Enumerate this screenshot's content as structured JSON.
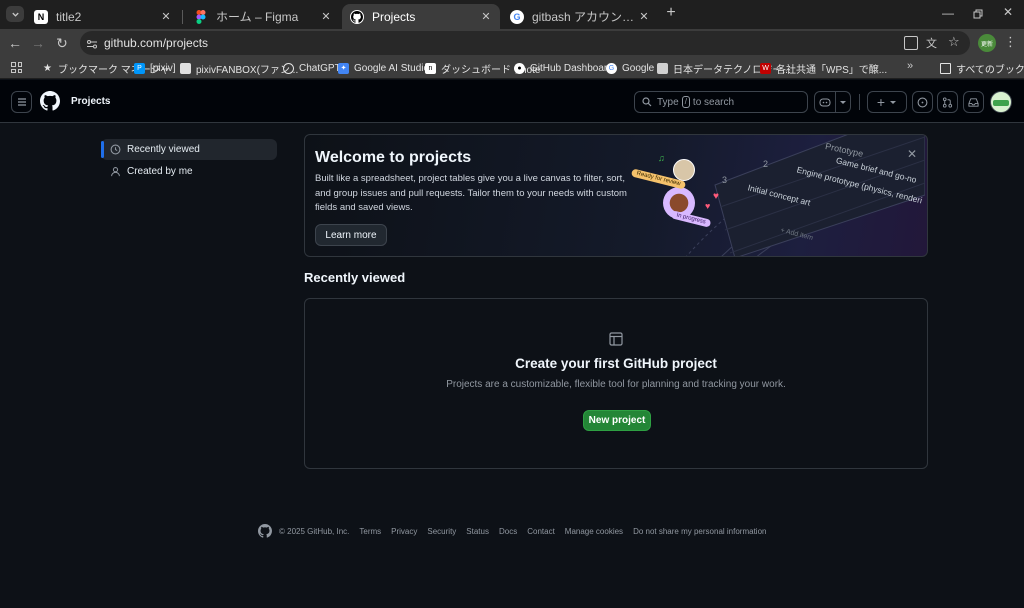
{
  "browser": {
    "tabs": [
      {
        "label": "title2",
        "icon": "notion-icon",
        "active": false
      },
      {
        "label": "ホーム – Figma",
        "icon": "figma-icon",
        "active": false
      },
      {
        "label": "Projects",
        "icon": "github-icon",
        "active": true
      },
      {
        "label": "gitbash アカウント 確認 - Google",
        "icon": "google-icon",
        "active": false
      }
    ],
    "url": "github.com/projects",
    "profile_label": "更新",
    "bookmarks": [
      {
        "label": "ブックマーク マネージャ"
      },
      {
        "label": "[pixiv]"
      },
      {
        "label": "pixivFANBOX(ファン..."
      },
      {
        "label": "ChatGPT"
      },
      {
        "label": "Google AI Studio"
      },
      {
        "label": "ダッシュボード｜note"
      },
      {
        "label": "GitHub Dashboard"
      },
      {
        "label": "Google"
      },
      {
        "label": "日本データテクノロジー..."
      },
      {
        "label": "各社共通「WPS」で醸..."
      }
    ],
    "all_bookmarks_label": "すべてのブックマーク"
  },
  "header": {
    "title": "Projects",
    "search_prefix": "Type",
    "search_key": "/",
    "search_suffix": "to search"
  },
  "sidebar": {
    "items": [
      {
        "label": "Recently viewed",
        "icon": "clock-icon",
        "selected": true
      },
      {
        "label": "Created by me",
        "icon": "person-icon",
        "selected": false
      }
    ]
  },
  "welcome": {
    "title": "Welcome to projects",
    "description": "Built like a spreadsheet, project tables give you a live canvas to filter, sort, and group issues and pull requests. Tailor them to your needs with custom fields and saved views.",
    "learn_more_label": "Learn more",
    "illustration": {
      "col1": "Prototype",
      "item1": "Game brief and go-no",
      "item2": "Engine prototype (physics, renderi",
      "item3": "Initial concept art",
      "add_item": "+ Add item",
      "badge_ready": "Ready for review",
      "badge_progress": "In progress",
      "num2": "2",
      "num3": "3"
    }
  },
  "recent": {
    "heading": "Recently viewed",
    "empty_title": "Create your first GitHub project",
    "empty_desc": "Projects are a customizable, flexible tool for planning and tracking your work.",
    "new_project_label": "New project"
  },
  "footer": {
    "copyright": "© 2025 GitHub, Inc.",
    "links": [
      "Terms",
      "Privacy",
      "Security",
      "Status",
      "Docs",
      "Contact",
      "Manage cookies",
      "Do not share my personal information"
    ]
  },
  "colors": {
    "accent_blue": "#1f6feb",
    "primary_green": "#238636",
    "page_bg": "#0d1117"
  }
}
